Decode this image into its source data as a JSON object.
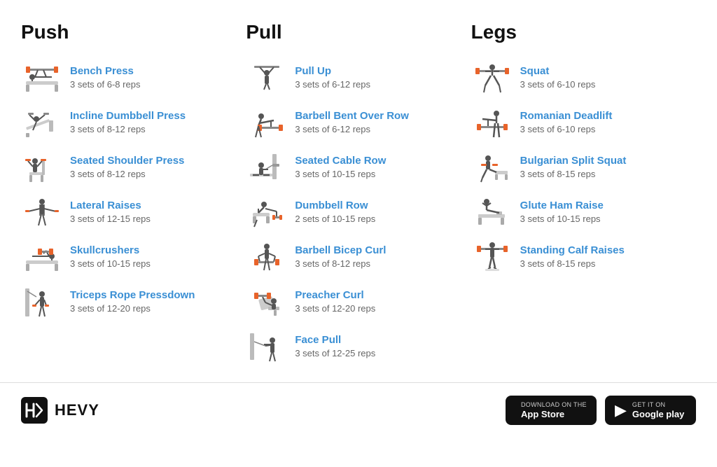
{
  "columns": [
    {
      "id": "push",
      "title": "Push",
      "exercises": [
        {
          "name": "Bench Press",
          "sets": "3 sets of 6-8 reps",
          "icon": "bench-press"
        },
        {
          "name": "Incline Dumbbell Press",
          "sets": "3 sets of 8-12 reps",
          "icon": "incline-dumbbell"
        },
        {
          "name": "Seated Shoulder Press",
          "sets": "3 sets of 8-12 reps",
          "icon": "shoulder-press"
        },
        {
          "name": "Lateral Raises",
          "sets": "3 sets of 12-15 reps",
          "icon": "lateral-raise"
        },
        {
          "name": "Skullcrushers",
          "sets": "3 sets of 10-15 reps",
          "icon": "skullcrushers"
        },
        {
          "name": "Triceps Rope Pressdown",
          "sets": "3 sets of 12-20 reps",
          "icon": "triceps-rope"
        }
      ]
    },
    {
      "id": "pull",
      "title": "Pull",
      "exercises": [
        {
          "name": "Pull Up",
          "sets": "3 sets of 6-12 reps",
          "icon": "pull-up"
        },
        {
          "name": "Barbell Bent Over Row",
          "sets": "3 sets of 6-12 reps",
          "icon": "bent-over-row"
        },
        {
          "name": "Seated Cable Row",
          "sets": "3 sets of 10-15 reps",
          "icon": "cable-row"
        },
        {
          "name": "Dumbbell Row",
          "sets": "2 sets of 10-15 reps",
          "icon": "dumbbell-row"
        },
        {
          "name": "Barbell Bicep Curl",
          "sets": "3 sets of 8-12 reps",
          "icon": "bicep-curl"
        },
        {
          "name": "Preacher Curl",
          "sets": "3 sets of 12-20 reps",
          "icon": "preacher-curl"
        },
        {
          "name": "Face Pull",
          "sets": "3 sets of 12-25 reps",
          "icon": "face-pull"
        }
      ]
    },
    {
      "id": "legs",
      "title": "Legs",
      "exercises": [
        {
          "name": "Squat",
          "sets": "3 sets of 6-10 reps",
          "icon": "squat"
        },
        {
          "name": "Romanian Deadlift",
          "sets": "3 sets of 6-10 reps",
          "icon": "romanian-deadlift"
        },
        {
          "name": "Bulgarian Split Squat",
          "sets": "3 sets of 8-15 reps",
          "icon": "bulgarian-split"
        },
        {
          "name": "Glute Ham Raise",
          "sets": "3 sets of 10-15 reps",
          "icon": "glute-ham"
        },
        {
          "name": "Standing Calf Raises",
          "sets": "3 sets of 8-15 reps",
          "icon": "calf-raises"
        }
      ]
    }
  ],
  "footer": {
    "logo_text": "HEVY",
    "app_store_sub": "Download on the",
    "app_store_main": "App Store",
    "google_play_sub": "GET IT ON",
    "google_play_main": "Google play"
  }
}
